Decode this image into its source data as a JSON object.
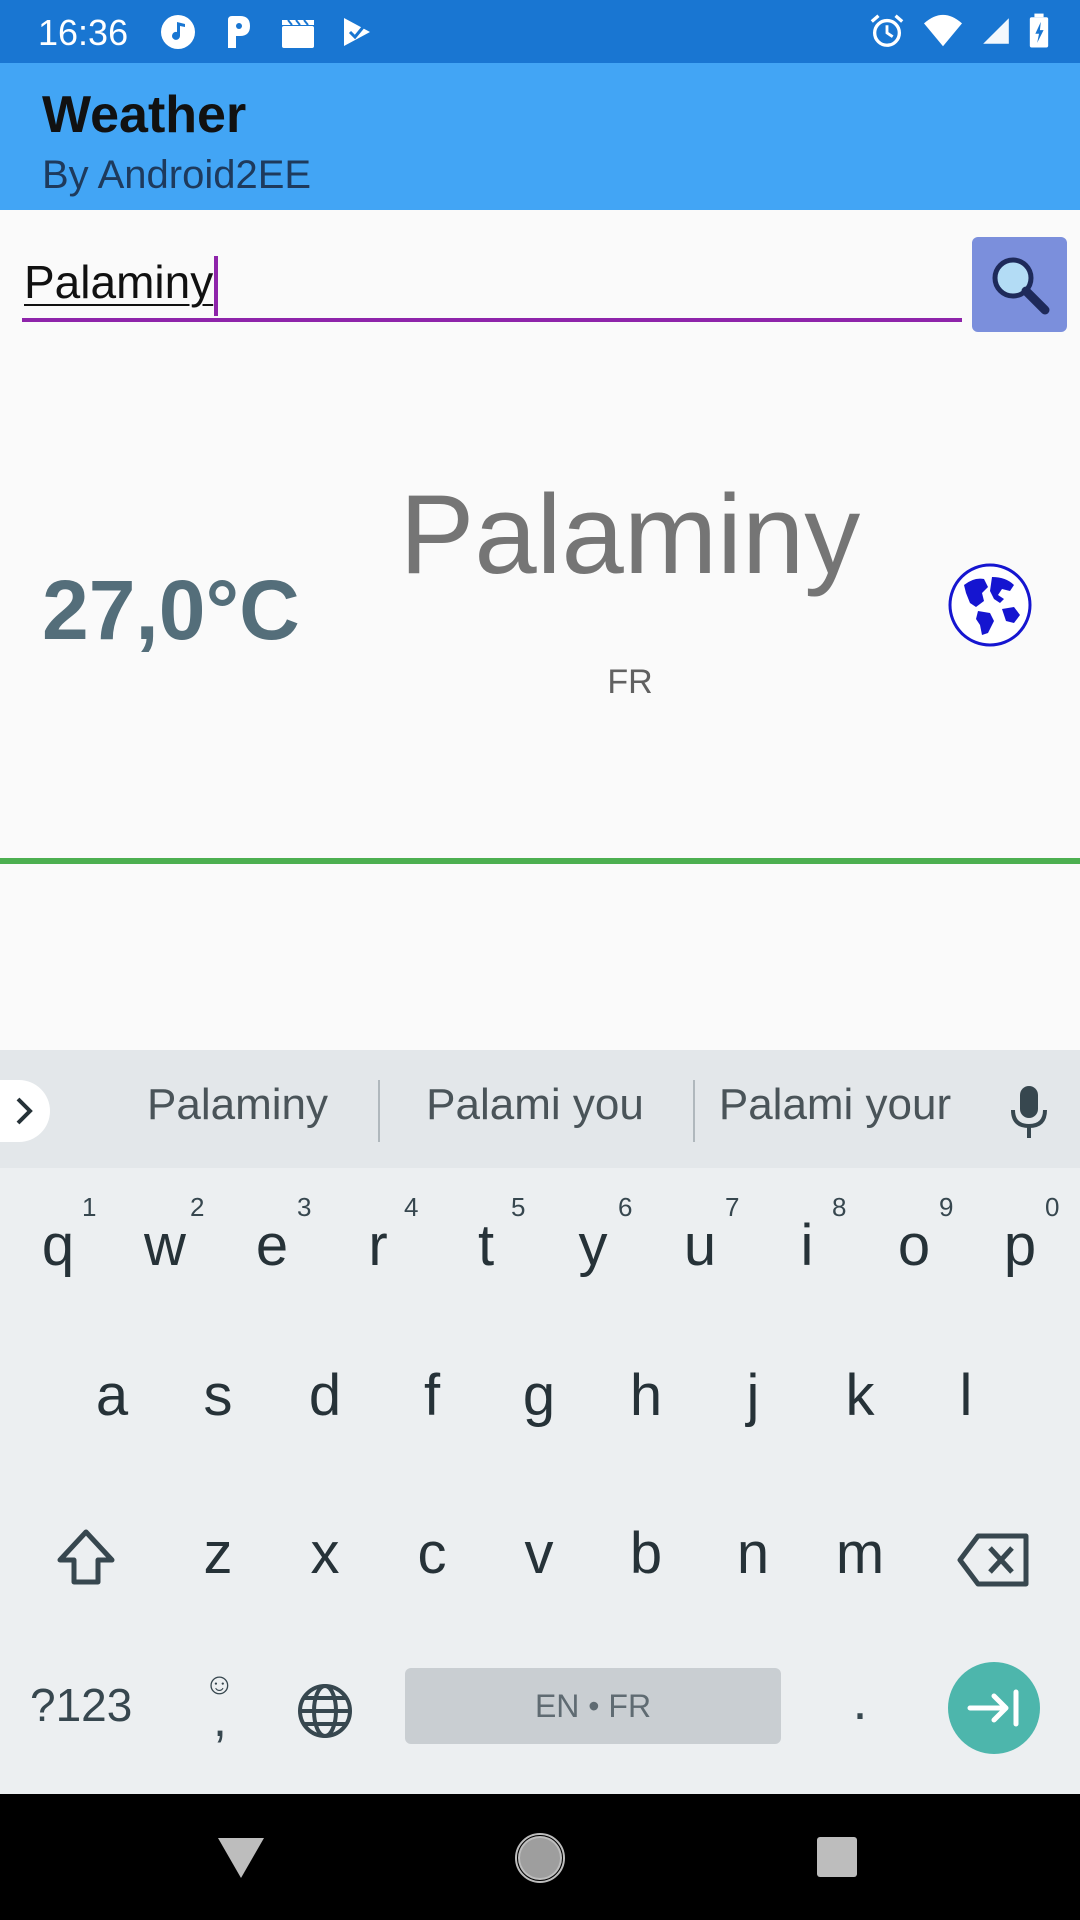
{
  "status_bar": {
    "time": "16:36",
    "notification_icons": [
      "music-icon",
      "parking-icon",
      "clapperboard-icon",
      "check-icon"
    ],
    "system_icons": [
      "alarm-icon",
      "wifi-icon",
      "signal-icon",
      "battery-charging-icon"
    ]
  },
  "app_bar": {
    "title": "Weather",
    "subtitle": "By Android2EE",
    "color": "#42a5f5"
  },
  "search": {
    "value": "Palaminy",
    "button_icon": "search-icon"
  },
  "weather": {
    "temperature": "27,0°C",
    "city": "Palaminy",
    "country": "FR",
    "icon": "globe-icon"
  },
  "keyboard": {
    "suggestions": [
      "Palaminy",
      "Palami you",
      "Palami your"
    ],
    "row1": [
      "q",
      "w",
      "e",
      "r",
      "t",
      "y",
      "u",
      "i",
      "o",
      "p"
    ],
    "row1_hints": [
      "1",
      "2",
      "3",
      "4",
      "5",
      "6",
      "7",
      "8",
      "9",
      "0"
    ],
    "row2": [
      "a",
      "s",
      "d",
      "f",
      "g",
      "h",
      "j",
      "k",
      "l"
    ],
    "row3": [
      "z",
      "x",
      "c",
      "v",
      "b",
      "n",
      "m"
    ],
    "symbols_label": "?123",
    "comma": ",",
    "emoji_hint": "☺",
    "space_label": "EN • FR",
    "period": "."
  },
  "colors": {
    "status_bar": "#1976d2",
    "input_underline": "#8e24aa",
    "search_button": "#7b8fdc",
    "divider": "#4caf50",
    "enter_key": "#4db6ac"
  }
}
